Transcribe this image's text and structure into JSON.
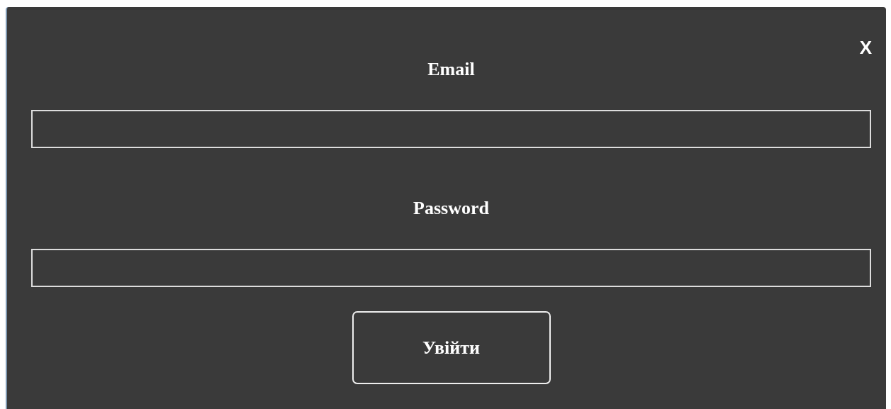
{
  "dialog": {
    "close": "X",
    "fields": [
      {
        "label": "Email"
      },
      {
        "label": "Password"
      }
    ],
    "submit": "Увійти"
  }
}
